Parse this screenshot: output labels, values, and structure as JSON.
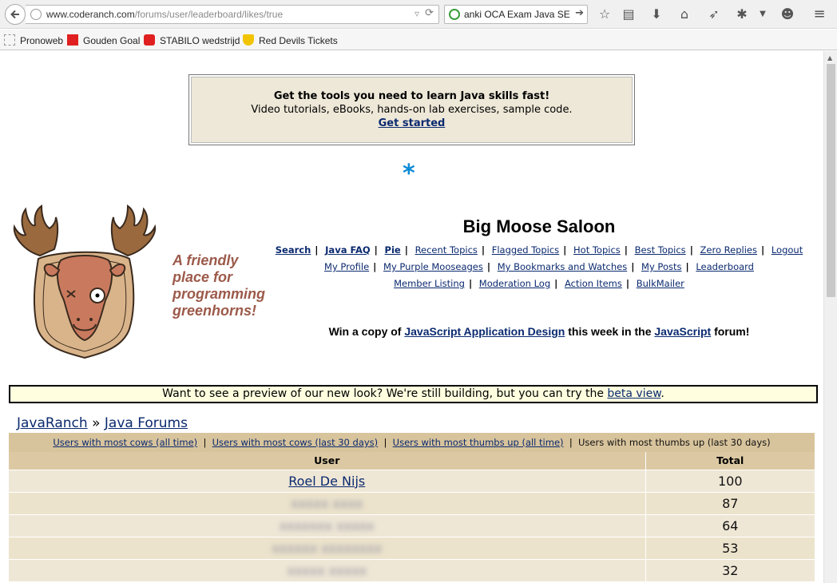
{
  "browser": {
    "url_host": "www.coderanch.com",
    "url_path": "/forums/user/leaderboard/likes/true",
    "search_text": "anki OCA Exam Java SE -",
    "bookmarks": [
      "Pronoweb",
      "Gouden Goal",
      "STABILO wedstrijd",
      "Red Devils Tickets"
    ]
  },
  "ad": {
    "headline": "Get the tools you need to learn Java skills fast!",
    "body": "Video tutorials, eBooks, hands-on lab exercises, sample code.",
    "link": "Get started"
  },
  "site": {
    "title": "Big Moose Saloon",
    "tagline": [
      "A friendly",
      "place for",
      "programming",
      "greenhorns!"
    ]
  },
  "nav": {
    "row1": [
      "Search",
      "Java FAQ",
      "Pie",
      "Recent Topics",
      "Flagged Topics",
      "Hot Topics",
      "Best Topics",
      "Zero Replies",
      "Logout"
    ],
    "row2": [
      "My Profile",
      "My Purple Mooseages",
      "My Bookmarks and Watches",
      "My Posts",
      "Leaderboard"
    ],
    "row3": [
      "Member Listing",
      "Moderation Log",
      "Action Items",
      "BulkMailer"
    ]
  },
  "promo": {
    "prefix": "Win a copy of ",
    "book": "JavaScript Application Design",
    "middle": " this week in the ",
    "forum": "JavaScript",
    "suffix": " forum!"
  },
  "beta": {
    "text": "Want to see a preview of our new look? We're still building, but you can try the ",
    "link": "beta view",
    "end": "."
  },
  "breadcrumb": {
    "home": "JavaRanch",
    "sep": "»",
    "forum": "Java Forums"
  },
  "leaderboard": {
    "tabs": [
      "Users with most cows (all time)",
      "Users with most cows (last 30 days)",
      "Users with most thumbs up (all time)"
    ],
    "current": "Users with most thumbs up (last 30 days)",
    "col_user": "User",
    "col_total": "Total",
    "rows": [
      {
        "user": "Roel De Nijs",
        "total": "100"
      },
      {
        "user": "xxxxx xxxx",
        "total": "87"
      },
      {
        "user": "xxxxxxx xxxxx",
        "total": "64"
      },
      {
        "user": "xxxxxx xxxxxxxx",
        "total": "53"
      },
      {
        "user": "xxxxx xxxxx",
        "total": "32"
      }
    ]
  }
}
